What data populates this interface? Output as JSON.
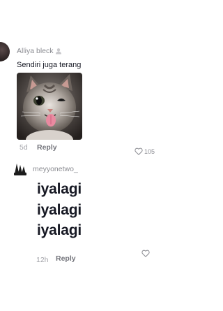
{
  "comments": [
    {
      "username": "Alliya bleck",
      "text": "Sendiri juga terang",
      "time": "5d",
      "reply_label": "Reply",
      "like_count": "105",
      "image": "cat-tongue-photo"
    },
    {
      "username": "meyyonetwo_",
      "lines": [
        "iyalagi",
        "iyalagi",
        "iyalagi"
      ],
      "time": "12h",
      "reply_label": "Reply",
      "like_count": ""
    }
  ],
  "icons": {
    "heart": "heart-outline-icon",
    "badge": "person-badge-icon"
  },
  "colors": {
    "text_primary": "#161823",
    "text_secondary": "#8a8b91",
    "text_muted": "#a3a4a9"
  }
}
